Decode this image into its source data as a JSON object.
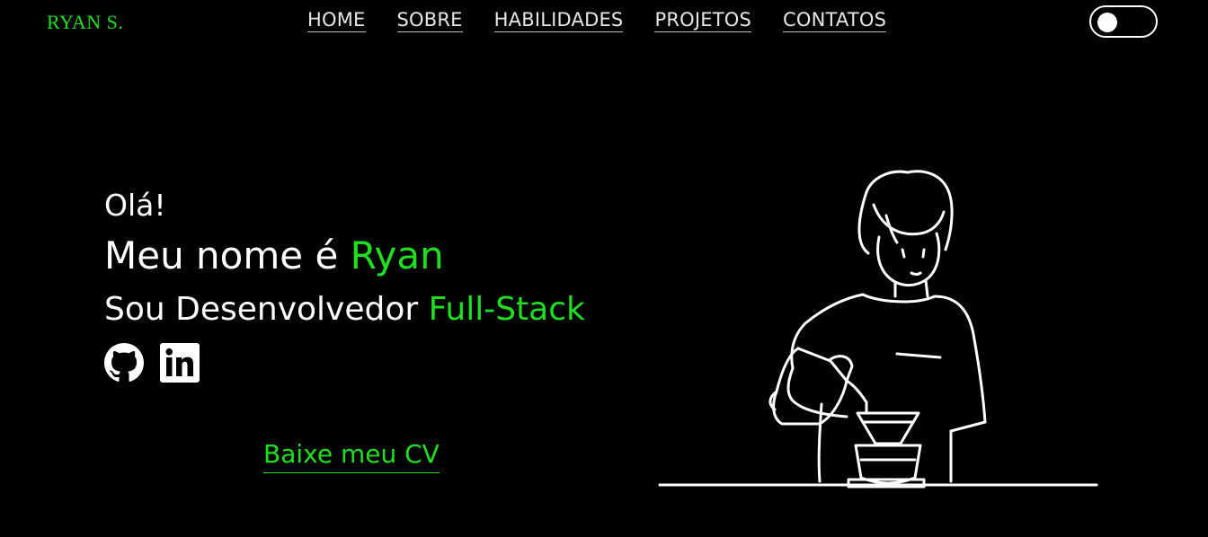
{
  "brand": {
    "logo": "RYAN S."
  },
  "nav": {
    "items": [
      "HOME",
      "SOBRE",
      "HABILIDADES",
      "PROJETOS",
      "CONTATOS"
    ]
  },
  "theme_toggle": {
    "state": "off"
  },
  "hero": {
    "greeting": "Olá!",
    "name_prefix": "Meu nome é ",
    "name_highlight": "Ryan",
    "role_prefix": "Sou Desenvolvedor ",
    "role_highlight": "Full-Stack"
  },
  "socials": [
    {
      "icon": "github-icon"
    },
    {
      "icon": "linkedin-icon"
    }
  ],
  "cta": {
    "download_cv": "Baixe meu CV"
  },
  "colors": {
    "accent": "#1fe01f",
    "background": "#000000",
    "text": "#ffffff"
  }
}
